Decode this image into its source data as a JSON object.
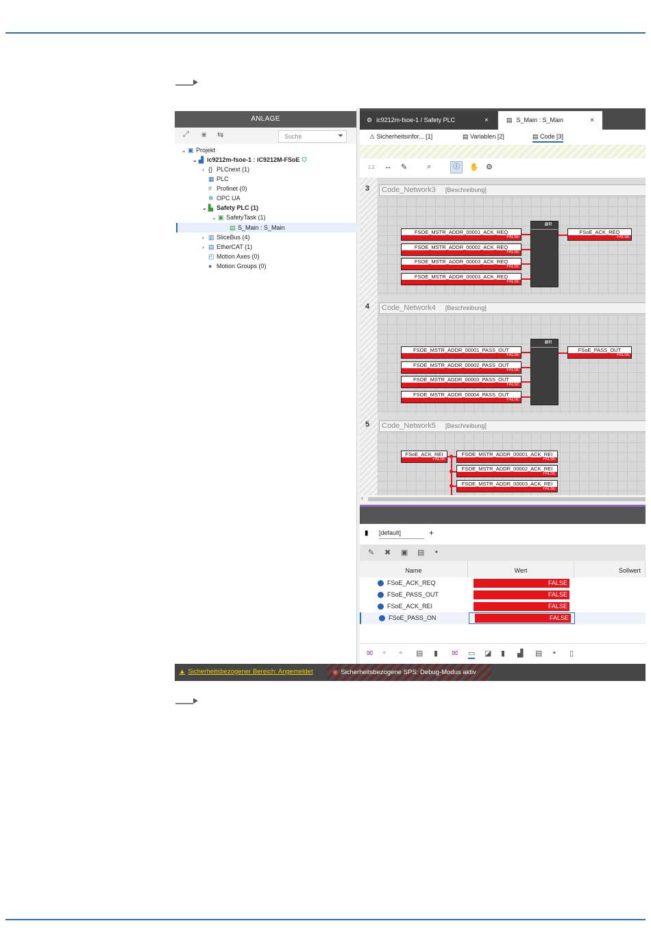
{
  "left_panel": {
    "title": "ANLAGE",
    "search_placeholder": "Suche",
    "tree": [
      {
        "label": "Projekt",
        "icon": "project-icon"
      },
      {
        "label": "ic9212m-fsoe-1 : iC9212M-FSoE",
        "icon": "controller-icon"
      },
      {
        "label": "PLCnext (1)",
        "icon": "braces-icon"
      },
      {
        "label": "PLC",
        "icon": "plc-icon"
      },
      {
        "label": "Profinet (0)",
        "icon": "network-icon"
      },
      {
        "label": "OPC UA",
        "icon": "opcua-icon"
      },
      {
        "label": "Safety PLC (1)",
        "icon": "safety-plc-icon"
      },
      {
        "label": "SafetyTask (1)",
        "icon": "task-icon"
      },
      {
        "label": "S_Main : S_Main",
        "icon": "program-icon"
      },
      {
        "label": "SliceBus (4)",
        "icon": "slicebus-icon"
      },
      {
        "label": "EtherCAT (1)",
        "icon": "ethercat-icon"
      },
      {
        "label": "Motion Axes (0)",
        "icon": "axes-icon"
      },
      {
        "label": "Motion Groups (0)",
        "icon": "groups-icon"
      }
    ]
  },
  "editor_tabs": {
    "tab1": "ic9212m-fsoe-1 / Safety PLC",
    "tab2": "S_Main : S_Main",
    "close": "×"
  },
  "sub_tabs": {
    "info": "Sicherheitsinfor...  [1]",
    "vars": "Variablen  [2]",
    "code": "Code  [3]"
  },
  "code_tools": {
    "zoom_label": "1:2"
  },
  "networks": [
    {
      "number": "3",
      "name": "Code_Network3",
      "desc": "[Beschreibung]",
      "block": "OR",
      "inputs": [
        {
          "name": "FSOE_MSTR_ADDR_00001_ACK_REQ",
          "value": "FALSE"
        },
        {
          "name": "FSOE_MSTR_ADDR_00002_ACK_REQ",
          "value": "FALSE"
        },
        {
          "name": "FSOE_MSTR_ADDR_00003_ACK_REQ",
          "value": "FALSE"
        },
        {
          "name": "FSOE_MSTR_ADDR_00003_ACK_REQ",
          "value": "FALSE"
        }
      ],
      "output": {
        "name": "FSoE_ACK_REQ",
        "value": "FALSE"
      }
    },
    {
      "number": "4",
      "name": "Code_Network4",
      "desc": "[Beschreibung]",
      "block": "OR",
      "inputs": [
        {
          "name": "FSOE_MSTR_ADDR_00001_PASS_OUT",
          "value": "FALSE"
        },
        {
          "name": "FSOE_MSTR_ADDR_00002_PASS_OUT",
          "value": "FALSE"
        },
        {
          "name": "FSOE_MSTR_ADDR_00003_PASS_OUT",
          "value": "FALSE"
        },
        {
          "name": "FSOE_MSTR_ADDR_00004_PASS_OUT",
          "value": "FALSE"
        }
      ],
      "output": {
        "name": "FSoE_PASS_OUT",
        "value": "FALSE"
      }
    },
    {
      "number": "5",
      "name": "Code_Network5",
      "desc": "[Beschreibung]",
      "source": {
        "name": "FSoE_ACK_REI",
        "value": "FALSE"
      },
      "targets": [
        {
          "name": "FSOE_MSTR_ADDR_00001_ACK_REI",
          "value": "FALSE"
        },
        {
          "name": "FSOE_MSTR_ADDR_00002_ACK_REI",
          "value": "FALSE"
        },
        {
          "name": "FSOE_MSTR_ADDR_00003_ACK_REI",
          "value": "FALSE"
        }
      ]
    }
  ],
  "watch": {
    "tab": "[default]",
    "add": "+",
    "columns": {
      "name": "Name",
      "value": "Wert",
      "setpoint": "Sollwert"
    },
    "rows": [
      {
        "name": "FSoE_ACK_REQ",
        "value": "FALSE"
      },
      {
        "name": "FSoE_PASS_OUT",
        "value": "FALSE"
      },
      {
        "name": "FSoE_ACK_REI",
        "value": "FALSE"
      },
      {
        "name": "FSoE_PASS_ON",
        "value": "FALSE"
      }
    ]
  },
  "status_bar": {
    "left": "Sicherheitsbezogener Bereich: Angemeldet",
    "right": "Sicherheitsbezogene SPS: Debug-Modus aktiv"
  },
  "colors": {
    "accent": "#2a6fb5",
    "false_red": "#e5141a",
    "status_yellow": "#f2d200"
  }
}
